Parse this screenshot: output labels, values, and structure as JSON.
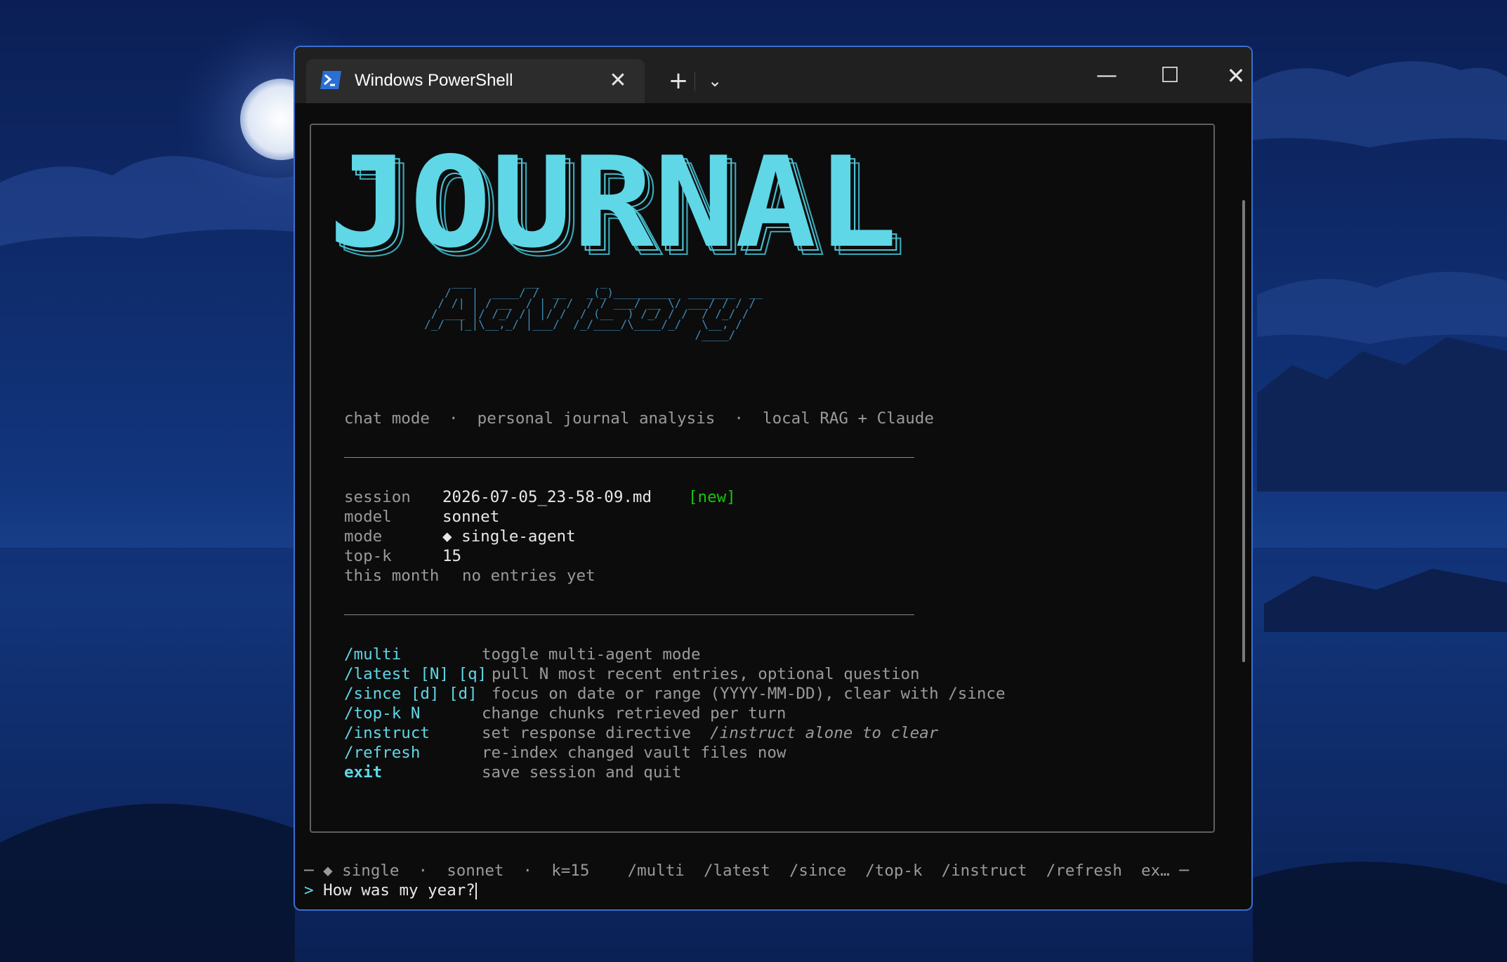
{
  "window": {
    "tab_title": "Windows PowerShell",
    "tab_icon": "powershell-icon",
    "close_tab_glyph": "✕",
    "new_tab_glyph": "+",
    "dropdown_glyph": "⌄",
    "min_glyph": "—",
    "max_glyph": "☐",
    "close_glyph": "✕"
  },
  "banner": {
    "logo_text": "JOURNAL",
    "logo_color": "#5fd7e6",
    "sub_logo_art": "         ___        __         _\n        /   |  ____/ /  __   _(_)_________  _______  __\n       / /| | / __  / | / /  / / ___/ __ \\/ ___/ / / /\n      / ___ |/ /_/ /| |/ /  / (__  ) /_/ / /  / /_/ /\n     /_/  |_|\\__,_/ |___/  /_/____/\\____/_/   \\__, /\n                                             /____/"
  },
  "subtitle": {
    "a": "chat mode",
    "b": "personal journal analysis",
    "c": "local RAG + Claude",
    "sep": "·"
  },
  "info": {
    "session_label": "session",
    "session_value": "2026-07-05_23-58-09.md",
    "session_badge": "[new]",
    "model_label": "model",
    "model_value": "sonnet",
    "mode_label": "mode",
    "mode_value": "◆ single-agent",
    "topk_label": "top-k",
    "topk_value": "15",
    "month_label": "this month",
    "month_value": "no entries yet"
  },
  "commands": [
    {
      "cmd": "/multi",
      "desc": "toggle multi-agent mode",
      "extra": ""
    },
    {
      "cmd": "/latest [N] [q]",
      "desc": "pull N most recent entries, optional question",
      "extra": ""
    },
    {
      "cmd": "/since [d] [d]",
      "desc": "focus on date or range (YYYY-MM-DD), clear with /since",
      "extra": ""
    },
    {
      "cmd": "/top-k N",
      "desc": "change chunks retrieved per turn",
      "extra": ""
    },
    {
      "cmd": "/instruct",
      "desc": "set response directive  ",
      "extra": "/instruct alone to clear"
    },
    {
      "cmd": "/refresh",
      "desc": "re-index changed vault files now",
      "extra": ""
    },
    {
      "cmd": "exit",
      "desc": "save session and quit",
      "extra": ""
    }
  ],
  "statusbar": {
    "text": "─ ◆ single  ·  sonnet  ·  k=15    /multi  /latest  /since  /top-k  /instruct  /refresh  ex… ─"
  },
  "prompt": {
    "caret": ">",
    "input": "How was my year?"
  },
  "colors": {
    "accent_cyan": "#5fd7e6",
    "new_badge_green": "#16c60c",
    "window_border": "#3a6fd0"
  }
}
